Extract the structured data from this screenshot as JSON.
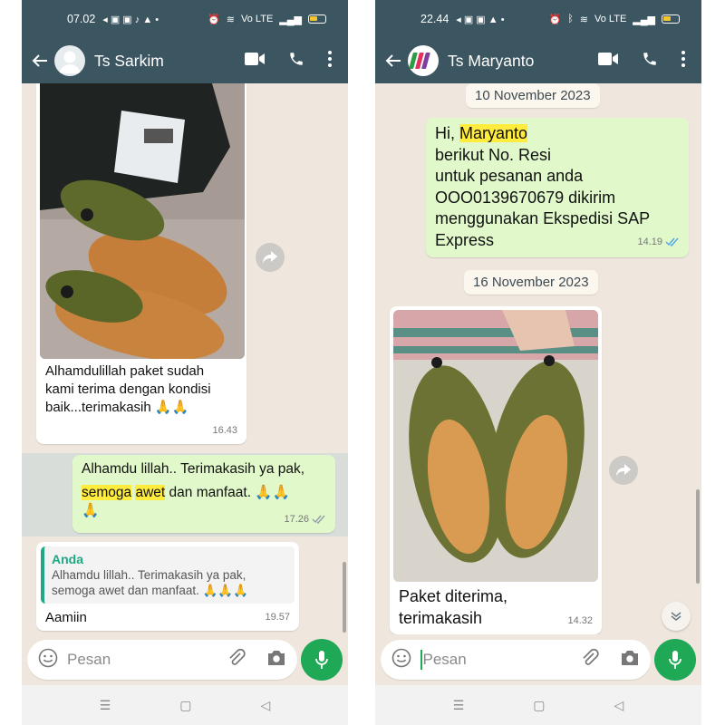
{
  "left": {
    "status": {
      "time": "07.02",
      "net": "Vo LTE"
    },
    "header": {
      "contact": "Ts Sarkim"
    },
    "messages": {
      "photo_caption": [
        "Alhamdulillah paket sudah",
        "kami terima dengan kondisi",
        "baik...terimakasih 🙏🙏"
      ],
      "photo_time": "16.43",
      "reply1_line1": "Alhamdu lillah..  Terimakasih ya pak,",
      "reply1_hl1": "semoga",
      "reply1_hl2": "awet",
      "reply1_rest": "dan manfaat. 🙏🙏",
      "reply1_line3": "🙏",
      "reply1_time": "17.26",
      "quote_author": "Anda",
      "quote_text": "Alhamdu lillah..  Terimakasih ya pak, semoga awet dan manfaat. 🙏🙏🙏",
      "reply2_text": "Aamiin",
      "reply2_time": "19.57"
    },
    "input": {
      "placeholder": "Pesan"
    }
  },
  "right": {
    "status": {
      "time": "22.44",
      "net": "Vo LTE"
    },
    "header": {
      "contact": "Ts Maryanto"
    },
    "date1": "10 November 2023",
    "msg1": {
      "greeting": "Hi,",
      "name": "Maryanto",
      "lines": [
        "berikut No. Resi",
        "untuk pesanan anda",
        "OOO0139670679 dikirim",
        "menggunakan Ekspedisi SAP",
        "Express"
      ],
      "time": "14.19"
    },
    "date2": "16 November 2023",
    "msg2": {
      "caption": [
        "Paket diterima,",
        "terimakasih"
      ],
      "time": "14.32"
    },
    "input": {
      "placeholder": "Pesan"
    }
  },
  "colors": {
    "header": "#3b5561",
    "chat_bg": "#efe7dd",
    "outgoing": "#e1f8cb",
    "incoming": "#ffffff",
    "accent_green": "#1fa855",
    "highlight": "#ffec3d",
    "read_ticks": "#4fa7e8"
  },
  "icons": [
    "back-arrow-icon",
    "avatar-icon",
    "video-call-icon",
    "phone-icon",
    "more-vert-icon",
    "forward-icon",
    "emoji-icon",
    "attach-icon",
    "camera-icon",
    "mic-icon",
    "scroll-down-icon",
    "recents-icon",
    "home-icon",
    "back-nav-icon",
    "double-check-icon"
  ]
}
